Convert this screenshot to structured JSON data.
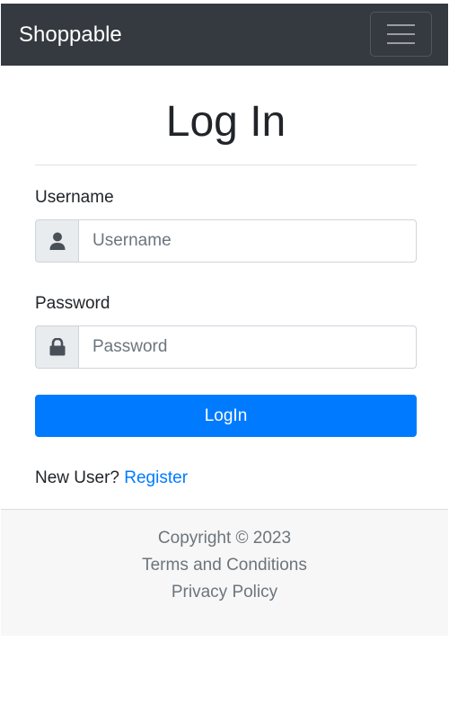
{
  "navbar": {
    "brand": "Shoppable",
    "toggler_icon": "hamburger-menu-icon"
  },
  "login": {
    "title": "Log In",
    "username": {
      "label": "Username",
      "placeholder": "Username",
      "value": "",
      "icon": "user-icon"
    },
    "password": {
      "label": "Password",
      "placeholder": "Password",
      "value": "",
      "icon": "lock-icon"
    },
    "submit_label": "LogIn",
    "new_user_text": "New User?",
    "register_link": "Register"
  },
  "footer": {
    "copyright": "Copyright © 2023",
    "terms_link": "Terms and Conditions",
    "privacy_link": "Privacy Policy"
  },
  "colors": {
    "navbar_bg": "#343a40",
    "primary": "#007bff",
    "footer_bg": "#f7f7f7",
    "muted_text": "#6c757d"
  }
}
